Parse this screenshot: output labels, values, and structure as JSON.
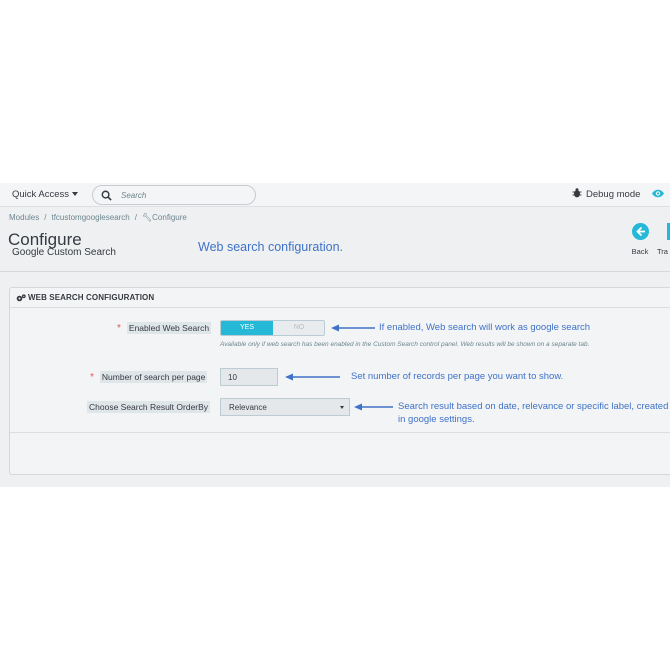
{
  "topbar": {
    "quick_access": "Quick Access",
    "search_placeholder": "Search",
    "debug_mode": "Debug mode"
  },
  "breadcrumb": [
    "Modules",
    "tfcustomgooglesearch",
    "Configure"
  ],
  "header": {
    "title": "Configure",
    "subtitle": "Google Custom Search",
    "note": "Web search configuration.",
    "back_label": "Back",
    "translate_label": "Tra"
  },
  "panel": {
    "title": "WEB SEARCH CONFIGURATION",
    "fields": {
      "enabled": {
        "label": "Enabled Web Search",
        "yes": "YES",
        "no": "NO",
        "selected": "YES",
        "help": "Available only if web search has been enabled in the Custom Search control panel. Web results will be shown on a separate tab.",
        "note": "If enabled, Web search will work as google search"
      },
      "per_page": {
        "label": "Number of search per page",
        "value": "10",
        "note": "Set number of records per page you want to show."
      },
      "order_by": {
        "label": "Choose Search Result OrderBy",
        "value": "Relevance",
        "note_line1": "Search result based on date, relevance or specific label, created",
        "note_line2": "in google settings."
      }
    }
  },
  "colors": {
    "accent": "#25b9d7",
    "annotation": "#3f72c8",
    "required": "#e15656"
  },
  "icons": [
    "search-icon",
    "bug-icon",
    "eye-icon",
    "wrench-icon",
    "back-arrow-icon",
    "cogs-icon",
    "chevron-down-icon"
  ]
}
